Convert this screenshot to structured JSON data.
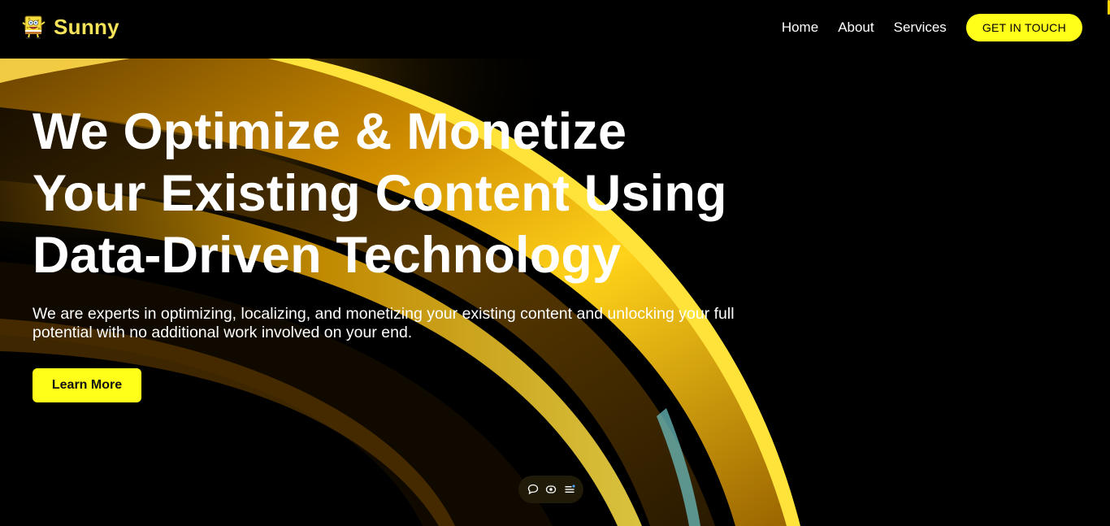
{
  "header": {
    "brand_name": "Sunny",
    "brand_logo": "sponge-character-logo",
    "nav": [
      "Home",
      "About",
      "Services"
    ],
    "cta_label": "GET IN TOUCH"
  },
  "hero": {
    "title_lines": [
      "We Optimize & Monetize",
      "Your Existing Content Using",
      "Data-Driven Technology"
    ],
    "subtitle": "We are experts in optimizing, localizing, and monetizing your existing content and unlocking your full potential with no additional work involved on your end.",
    "button_label": "Learn More",
    "background": "abstract-golden-curves"
  },
  "toolbar": {
    "icons": [
      "chat-bubble-icon",
      "eye-icon",
      "menu-list-icon"
    ]
  },
  "colors": {
    "accent": "#ffff1a",
    "brand": "#f5e35a",
    "background": "#000000",
    "text": "#ffffff"
  }
}
